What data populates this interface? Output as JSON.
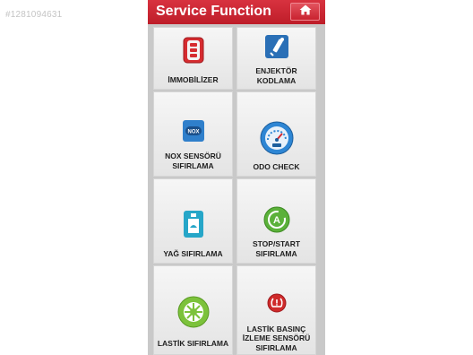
{
  "watermark": "#1281094631",
  "header": {
    "title": "Service Function",
    "home_icon": "home-icon"
  },
  "tiles": [
    {
      "label": "İMMOBİLİZER",
      "icon": "immobilizer-key-icon",
      "color": "#d62c30"
    },
    {
      "label": "ENJEKTÖR\nKODLAMA",
      "icon": "injector-icon",
      "color": "#2a6fb6"
    },
    {
      "label": "NOX SENSÖRÜ\nSIFIRLAMA",
      "icon": "nox-sensor-icon",
      "color": "#2f7fcb"
    },
    {
      "label": "ODO CHECK",
      "icon": "odometer-gauge-icon",
      "color": "#2e86d4"
    },
    {
      "label": "YAĞ SIFIRLAMA",
      "icon": "oil-can-icon",
      "color": "#26a6c8"
    },
    {
      "label": "STOP/START\nSIFIRLAMA",
      "icon": "auto-start-stop-icon",
      "color": "#5bb13a"
    },
    {
      "label": "LASTİK SIFIRLAMA",
      "icon": "tire-icon",
      "color": "#7cc23b"
    },
    {
      "label": "LASTİK BASINÇ\nİZLEME SENSÖRÜ\nSIFIRLAMA",
      "icon": "tire-pressure-icon",
      "color": "#cf2a2a"
    }
  ]
}
